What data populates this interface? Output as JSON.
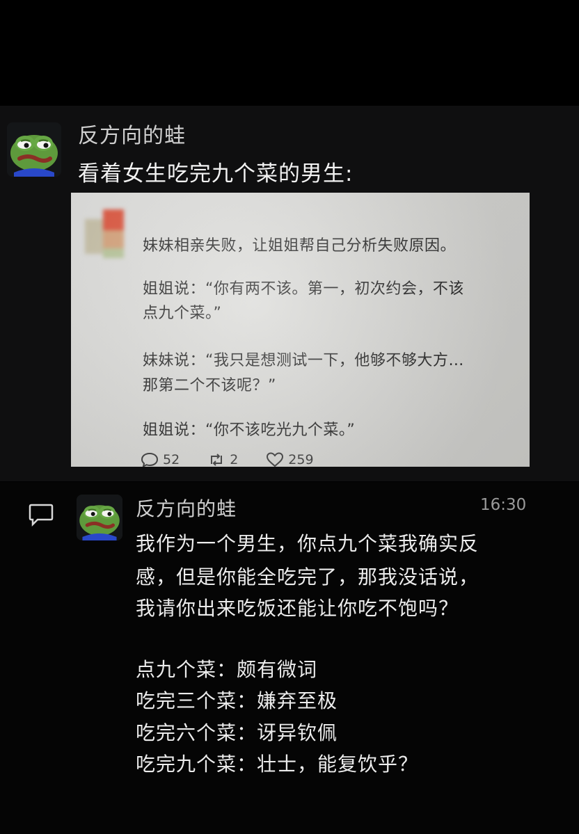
{
  "post": {
    "author": "反方向的蛙",
    "text": "看着女生吃完九个菜的男生:",
    "avatar_icon": "pepe-frog-avatar"
  },
  "embed": {
    "lines": [
      "妹妹相亲失败，让姐姐帮自己分析失败原因。",
      "姐姐说：“你有两不该。第一，初次约会，不该",
      "点九个菜。”",
      "妹妹说：“我只是想测试一下，他够不够大方…",
      "那第二个不该呢？”",
      "姐姐说：“你不该吃光九个菜。”"
    ],
    "stats": {
      "comments": "52",
      "retweets": "2",
      "likes": "259"
    }
  },
  "comment": {
    "author": "反方向的蛙",
    "time": "16:30",
    "lines": [
      "我作为一个男生，你点九个菜我确实反",
      "感，但是你能全吃完了，那我没话说，",
      "我请你出来吃饭还能让你吃不饱吗？",
      "点九个菜：颇有微词",
      "吃完三个菜：嫌弃至极",
      "吃完六个菜：讶异钦佩",
      "吃完九个菜：壮士，能复饮乎？"
    ]
  },
  "colors": {
    "background": "#000000",
    "post_bg": "#0f0f10",
    "embed_bg": "#dcdcda",
    "text_primary": "#f2f2f2",
    "text_secondary": "#cfcfcf",
    "time": "#9a9a9a"
  }
}
